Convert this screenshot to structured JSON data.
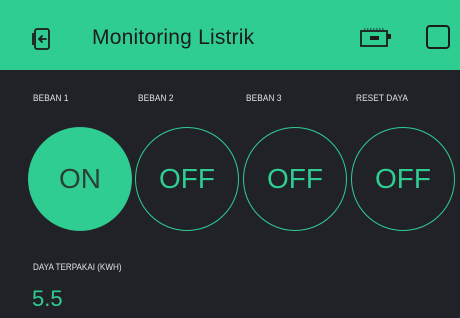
{
  "colors": {
    "accent": "#2fcd92",
    "background": "#212227",
    "topbar_text": "#1c1c1c"
  },
  "header": {
    "title": "Monitoring Listrik",
    "back_icon": "exit-door-icon",
    "device_icon": "device-board-icon",
    "menu_icon": "square-icon"
  },
  "widgets": [
    {
      "label": "BEBAN 1",
      "state": "ON"
    },
    {
      "label": "BEBAN 2",
      "state": "OFF"
    },
    {
      "label": "BEBAN 3",
      "state": "OFF"
    },
    {
      "label": "RESET DAYA",
      "state": "OFF"
    }
  ],
  "display": {
    "label": "DAYA TERPAKAI (KWH)",
    "value": "5.5"
  }
}
